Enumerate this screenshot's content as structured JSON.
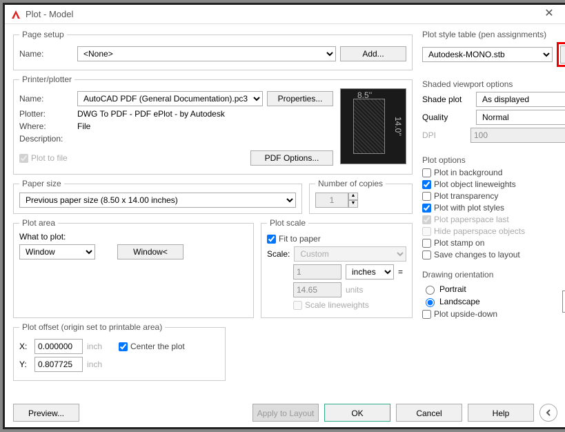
{
  "window": {
    "title": "Plot - Model"
  },
  "pageSetup": {
    "legend": "Page setup",
    "nameLabel": "Name:",
    "nameValue": "<None>",
    "addBtn": "Add..."
  },
  "printer": {
    "legend": "Printer/plotter",
    "nameLabel": "Name:",
    "nameValue": "AutoCAD PDF (General Documentation).pc3",
    "propsBtn": "Properties...",
    "plotterLabel": "Plotter:",
    "plotterValue": "DWG To PDF - PDF ePlot - by Autodesk",
    "whereLabel": "Where:",
    "whereValue": "File",
    "descLabel": "Description:",
    "plotToFile": "Plot to file",
    "pdfOptions": "PDF Options...",
    "previewW": "8.5''",
    "previewH": "14.0''"
  },
  "paper": {
    "legend": "Paper size",
    "value": "Previous paper size  (8.50 x 14.00 inches)",
    "copiesLegend": "Number of copies",
    "copies": "1"
  },
  "plotArea": {
    "legend": "Plot area",
    "whatLabel": "What to plot:",
    "whatValue": "Window",
    "windowBtn": "Window<"
  },
  "plotScale": {
    "legend": "Plot scale",
    "fit": "Fit to paper",
    "scaleLabel": "Scale:",
    "scaleValue": "Custom",
    "num": "1",
    "unit": "inches",
    "eq": "=",
    "den": "14.65",
    "unitsLbl": "units",
    "scaleLW": "Scale lineweights"
  },
  "offset": {
    "legend": "Plot offset (origin set to printable area)",
    "xLabel": "X:",
    "xValue": "0.000000",
    "yLabel": "Y:",
    "yValue": "0.807725",
    "inch": "inch",
    "center": "Center the plot"
  },
  "styleTable": {
    "legend": "Plot style table (pen assignments)",
    "value": "Autodesk-MONO.stb"
  },
  "shaded": {
    "legend": "Shaded viewport options",
    "shadeLabel": "Shade plot",
    "shadeValue": "As displayed",
    "qualityLabel": "Quality",
    "qualityValue": "Normal",
    "dpiLabel": "DPI",
    "dpiValue": "100"
  },
  "plotOptions": {
    "legend": "Plot options",
    "bg": "Plot in background",
    "lw": "Plot object lineweights",
    "trans": "Plot transparency",
    "styles": "Plot with plot styles",
    "psLast": "Plot paperspace last",
    "hidePs": "Hide paperspace objects",
    "stamp": "Plot stamp on",
    "save": "Save changes to layout"
  },
  "orient": {
    "legend": "Drawing orientation",
    "portrait": "Portrait",
    "landscape": "Landscape",
    "upside": "Plot upside-down"
  },
  "bottom": {
    "preview": "Preview...",
    "apply": "Apply to Layout",
    "ok": "OK",
    "cancel": "Cancel",
    "help": "Help"
  }
}
